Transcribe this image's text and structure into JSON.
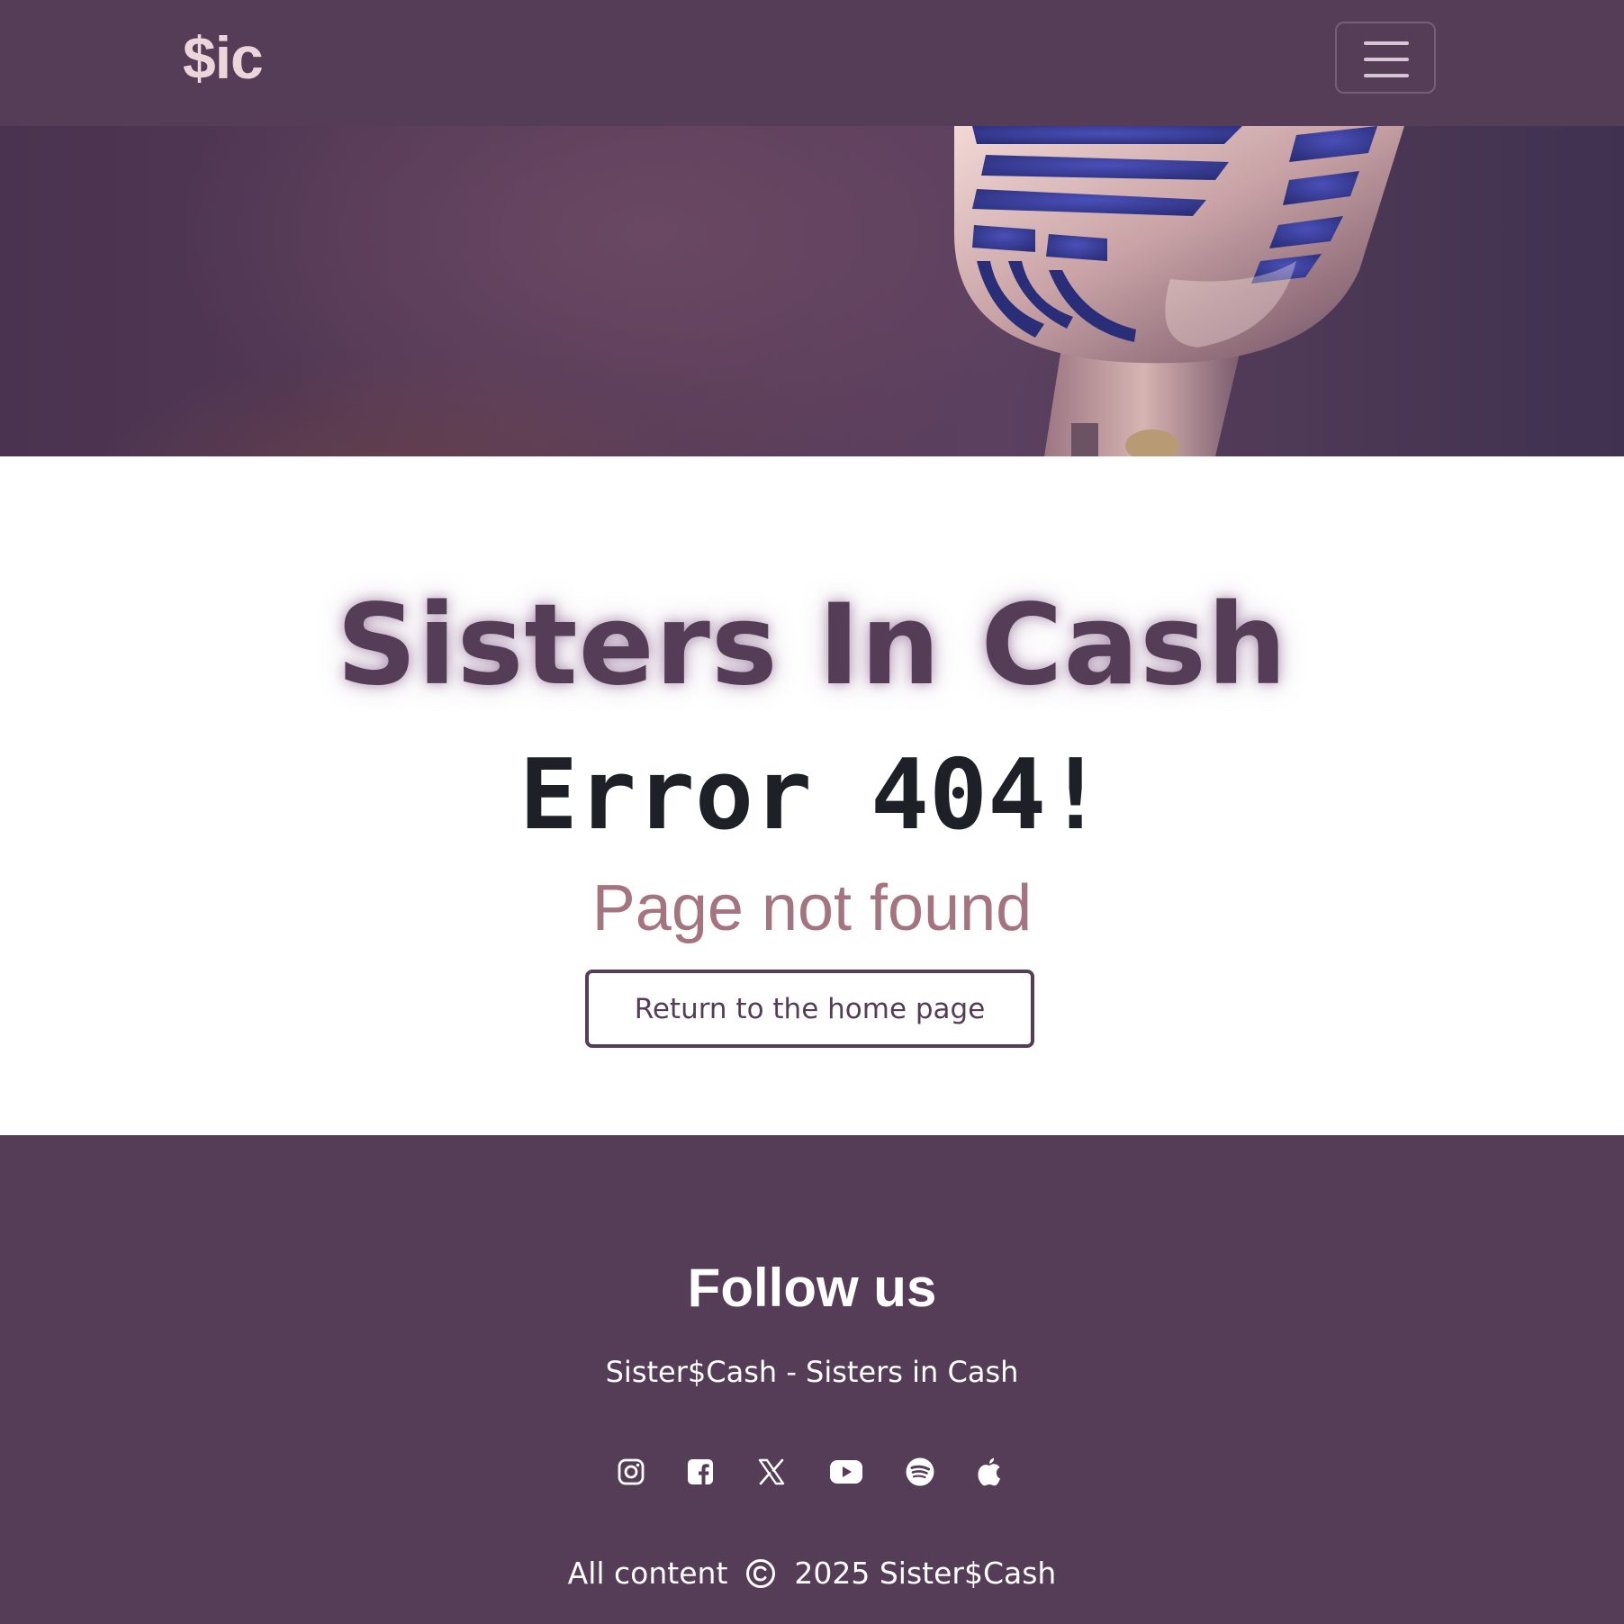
{
  "navbar": {
    "brand": "$ic",
    "toggler_icon": "hamburger-menu-icon"
  },
  "hero": {
    "image": "vintage-microphone-photo"
  },
  "main": {
    "site_title": "Sisters In Cash",
    "error_title": "Error 404!",
    "error_subtitle": "Page not found",
    "home_button_label": "Return to the home page"
  },
  "footer": {
    "heading": "Follow us",
    "tagline": "Sister$Cash - Sisters in Cash",
    "social_icons": [
      "instagram-icon",
      "facebook-icon",
      "x-twitter-icon",
      "youtube-icon",
      "spotify-icon",
      "apple-podcasts-icon"
    ],
    "copyright_prefix": "All content",
    "copyright_suffix": "2025 Sister$Cash"
  },
  "colors": {
    "brand_purple": "#553d57",
    "brand_text": "#ecd6d9",
    "subtitle_rose": "#a47581",
    "dark_text": "#1d2127"
  }
}
